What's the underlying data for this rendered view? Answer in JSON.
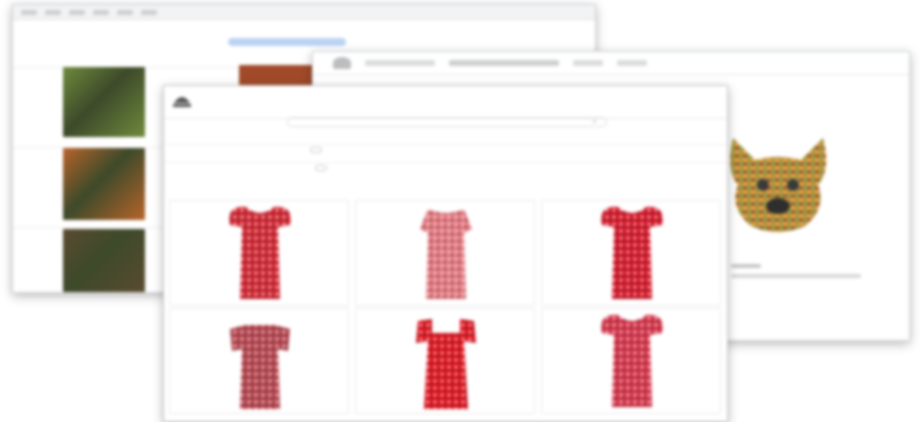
{
  "back_window": {
    "menu": [
      "",
      "",
      "",
      "",
      "",
      "",
      ""
    ],
    "thumb_colors": [
      "#6e8a3c",
      "#b8642a",
      "#5a4a30"
    ]
  },
  "right_window": {
    "nav_items": [
      "",
      "",
      "",
      "",
      ""
    ],
    "headline": "",
    "colors": {
      "dog": "#d0a060"
    }
  },
  "front_window": {
    "nav": {
      "items": [
        "",
        "",
        "",
        "",
        "",
        "",
        ""
      ],
      "sign_in": ""
    },
    "search": {
      "placeholder": ""
    },
    "filters": [
      {
        "label": "",
        "options": [
          "",
          "",
          "",
          "",
          "",
          ""
        ],
        "selected": 1
      },
      {
        "label": "",
        "options": [
          "",
          "",
          "",
          "",
          "",
          ""
        ],
        "selected": 1
      }
    ],
    "products": [
      {
        "style": "puff-sleeve",
        "color": "#d42632"
      },
      {
        "style": "cap-sleeve",
        "color": "#e77a82"
      },
      {
        "style": "puff-sleeve",
        "color": "#d8182a"
      },
      {
        "style": "cold-shoulder",
        "color": "#b8454f"
      },
      {
        "style": "square-neck",
        "color": "#e0141f"
      },
      {
        "style": "puff-sleeve",
        "color": "#d8344a"
      }
    ]
  }
}
